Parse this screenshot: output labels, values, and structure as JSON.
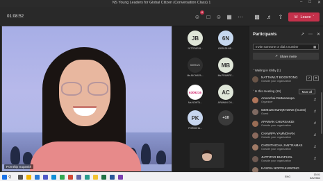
{
  "window": {
    "title": "NS Young Leaders for Global Citizen (Conversation Class) 1"
  },
  "toolbar": {
    "timer": "01:08:52",
    "participants_badge": "8",
    "leave_label": "Leave"
  },
  "main_video": {
    "speaker_name": "Pornthip Supasith"
  },
  "tiles": [
    {
      "initials": "JB",
      "label": "JUTTIPAR B...",
      "style": "green"
    },
    {
      "initials": "6N",
      "label": "6309126 NS...",
      "style": "blue"
    },
    {
      "initials": "6309121",
      "label": "Ms.NICHAPA...",
      "style": "dark"
    },
    {
      "initials": "MB",
      "label": "Ms.PRAWPE...",
      "style": "green"
    },
    {
      "initials": "6309216",
      "label": "Ms.NONTA...",
      "style": "img"
    },
    {
      "initials": "AC",
      "label": "APAWAN CH...",
      "style": "green"
    },
    {
      "initials": "PK",
      "label": "PORNCHA...",
      "style": "pk"
    },
    {
      "initials": "+10",
      "label": "",
      "style": "more"
    }
  ],
  "panel": {
    "title": "Participants",
    "invite_placeholder": "Invite someone or dial a number",
    "share_invite_label": "Share invite",
    "lobby_header": "Waiting in lobby (1)",
    "meeting_header": "In this meeting (19)",
    "mute_all_label": "Mute all",
    "lobby": [
      {
        "name": "NATTAWUT BOONTONG",
        "sub": "Outside your organization"
      }
    ],
    "participants": [
      {
        "name": "Amonchai Rattanasopa",
        "sub": "Organizer"
      },
      {
        "name": "6309126 ธนกฤต NSNS (Guest)",
        "sub": "Guest"
      },
      {
        "name": "APAWAN CHURSAKDI",
        "sub": "Outside your organization"
      },
      {
        "name": "CHAWIPA YAMNOHAN",
        "sub": "Outside your organization"
      },
      {
        "name": "CHONTHICHA JANTRAMAS",
        "sub": "Outside your organization"
      },
      {
        "name": "JUTTIPAR BUNPHOL",
        "sub": "Outside your organization"
      },
      {
        "name": "KASRIA NOPPAKUWONG",
        "sub": ""
      }
    ]
  },
  "taskbar": {
    "language": "ENG",
    "time": "15:01",
    "date": "8/6/2564"
  }
}
